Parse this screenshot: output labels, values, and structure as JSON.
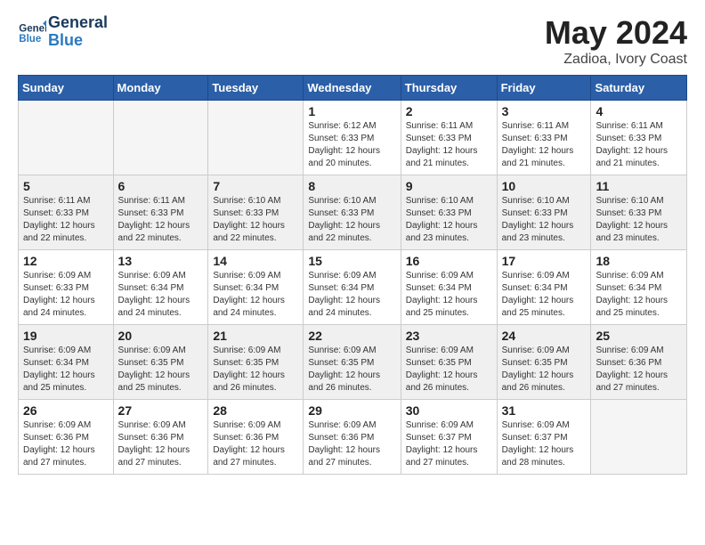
{
  "header": {
    "logo_line1": "General",
    "logo_line2": "Blue",
    "title": "May 2024",
    "location": "Zadioa, Ivory Coast"
  },
  "weekdays": [
    "Sunday",
    "Monday",
    "Tuesday",
    "Wednesday",
    "Thursday",
    "Friday",
    "Saturday"
  ],
  "weeks": [
    [
      {
        "day": "",
        "info": ""
      },
      {
        "day": "",
        "info": ""
      },
      {
        "day": "",
        "info": ""
      },
      {
        "day": "1",
        "info": "Sunrise: 6:12 AM\nSunset: 6:33 PM\nDaylight: 12 hours\nand 20 minutes."
      },
      {
        "day": "2",
        "info": "Sunrise: 6:11 AM\nSunset: 6:33 PM\nDaylight: 12 hours\nand 21 minutes."
      },
      {
        "day": "3",
        "info": "Sunrise: 6:11 AM\nSunset: 6:33 PM\nDaylight: 12 hours\nand 21 minutes."
      },
      {
        "day": "4",
        "info": "Sunrise: 6:11 AM\nSunset: 6:33 PM\nDaylight: 12 hours\nand 21 minutes."
      }
    ],
    [
      {
        "day": "5",
        "info": "Sunrise: 6:11 AM\nSunset: 6:33 PM\nDaylight: 12 hours\nand 22 minutes."
      },
      {
        "day": "6",
        "info": "Sunrise: 6:11 AM\nSunset: 6:33 PM\nDaylight: 12 hours\nand 22 minutes."
      },
      {
        "day": "7",
        "info": "Sunrise: 6:10 AM\nSunset: 6:33 PM\nDaylight: 12 hours\nand 22 minutes."
      },
      {
        "day": "8",
        "info": "Sunrise: 6:10 AM\nSunset: 6:33 PM\nDaylight: 12 hours\nand 22 minutes."
      },
      {
        "day": "9",
        "info": "Sunrise: 6:10 AM\nSunset: 6:33 PM\nDaylight: 12 hours\nand 23 minutes."
      },
      {
        "day": "10",
        "info": "Sunrise: 6:10 AM\nSunset: 6:33 PM\nDaylight: 12 hours\nand 23 minutes."
      },
      {
        "day": "11",
        "info": "Sunrise: 6:10 AM\nSunset: 6:33 PM\nDaylight: 12 hours\nand 23 minutes."
      }
    ],
    [
      {
        "day": "12",
        "info": "Sunrise: 6:09 AM\nSunset: 6:33 PM\nDaylight: 12 hours\nand 24 minutes."
      },
      {
        "day": "13",
        "info": "Sunrise: 6:09 AM\nSunset: 6:34 PM\nDaylight: 12 hours\nand 24 minutes."
      },
      {
        "day": "14",
        "info": "Sunrise: 6:09 AM\nSunset: 6:34 PM\nDaylight: 12 hours\nand 24 minutes."
      },
      {
        "day": "15",
        "info": "Sunrise: 6:09 AM\nSunset: 6:34 PM\nDaylight: 12 hours\nand 24 minutes."
      },
      {
        "day": "16",
        "info": "Sunrise: 6:09 AM\nSunset: 6:34 PM\nDaylight: 12 hours\nand 25 minutes."
      },
      {
        "day": "17",
        "info": "Sunrise: 6:09 AM\nSunset: 6:34 PM\nDaylight: 12 hours\nand 25 minutes."
      },
      {
        "day": "18",
        "info": "Sunrise: 6:09 AM\nSunset: 6:34 PM\nDaylight: 12 hours\nand 25 minutes."
      }
    ],
    [
      {
        "day": "19",
        "info": "Sunrise: 6:09 AM\nSunset: 6:34 PM\nDaylight: 12 hours\nand 25 minutes."
      },
      {
        "day": "20",
        "info": "Sunrise: 6:09 AM\nSunset: 6:35 PM\nDaylight: 12 hours\nand 25 minutes."
      },
      {
        "day": "21",
        "info": "Sunrise: 6:09 AM\nSunset: 6:35 PM\nDaylight: 12 hours\nand 26 minutes."
      },
      {
        "day": "22",
        "info": "Sunrise: 6:09 AM\nSunset: 6:35 PM\nDaylight: 12 hours\nand 26 minutes."
      },
      {
        "day": "23",
        "info": "Sunrise: 6:09 AM\nSunset: 6:35 PM\nDaylight: 12 hours\nand 26 minutes."
      },
      {
        "day": "24",
        "info": "Sunrise: 6:09 AM\nSunset: 6:35 PM\nDaylight: 12 hours\nand 26 minutes."
      },
      {
        "day": "25",
        "info": "Sunrise: 6:09 AM\nSunset: 6:36 PM\nDaylight: 12 hours\nand 27 minutes."
      }
    ],
    [
      {
        "day": "26",
        "info": "Sunrise: 6:09 AM\nSunset: 6:36 PM\nDaylight: 12 hours\nand 27 minutes."
      },
      {
        "day": "27",
        "info": "Sunrise: 6:09 AM\nSunset: 6:36 PM\nDaylight: 12 hours\nand 27 minutes."
      },
      {
        "day": "28",
        "info": "Sunrise: 6:09 AM\nSunset: 6:36 PM\nDaylight: 12 hours\nand 27 minutes."
      },
      {
        "day": "29",
        "info": "Sunrise: 6:09 AM\nSunset: 6:36 PM\nDaylight: 12 hours\nand 27 minutes."
      },
      {
        "day": "30",
        "info": "Sunrise: 6:09 AM\nSunset: 6:37 PM\nDaylight: 12 hours\nand 27 minutes."
      },
      {
        "day": "31",
        "info": "Sunrise: 6:09 AM\nSunset: 6:37 PM\nDaylight: 12 hours\nand 28 minutes."
      },
      {
        "day": "",
        "info": ""
      }
    ]
  ]
}
